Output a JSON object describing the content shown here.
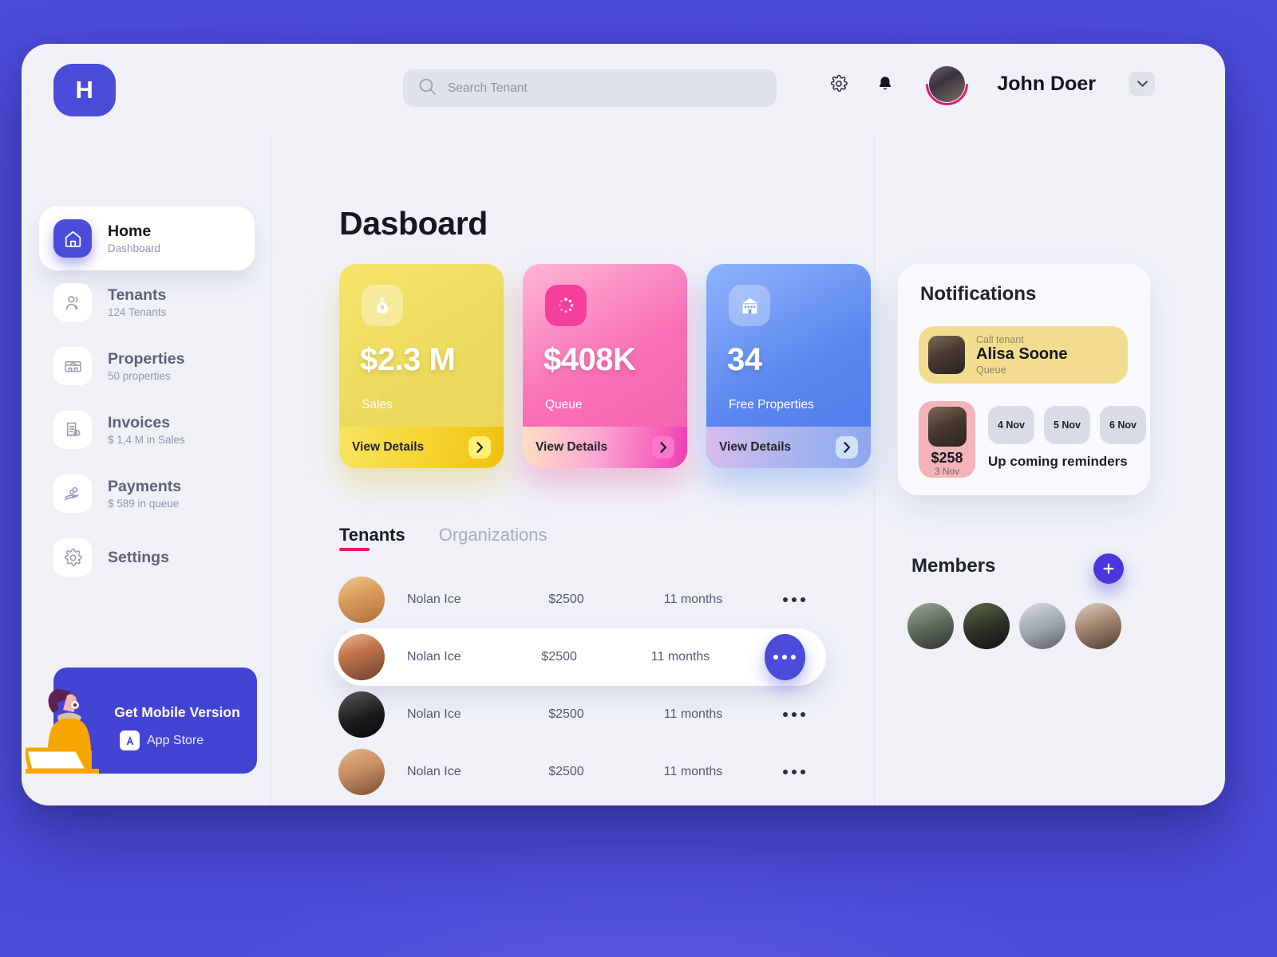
{
  "brand": {
    "logo_letter": "H",
    "accent": "#4b4cd9",
    "pink_accent": "#e8196b"
  },
  "topbar": {
    "search": {
      "placeholder": "Search Tenant",
      "value": ""
    },
    "settings_icon": "gear-icon",
    "bell_icon": "bell-icon",
    "user_name": "John Doer",
    "chevron_icon": "chevron-down-icon"
  },
  "sidebar": {
    "items": [
      {
        "label": "Home",
        "sub": "Dashboard",
        "icon": "home-icon",
        "active": true
      },
      {
        "label": "Tenants",
        "sub": "124 Tenants",
        "icon": "users-icon",
        "active": false
      },
      {
        "label": "Properties",
        "sub": "50 properties",
        "icon": "building-icon",
        "active": false
      },
      {
        "label": "Invoices",
        "sub": "$ 1,4 M in Sales",
        "icon": "invoice-icon",
        "active": false
      },
      {
        "label": "Payments",
        "sub": "$ 589 in queue",
        "icon": "payment-icon",
        "active": false
      },
      {
        "label": "Settings",
        "sub": "",
        "icon": "gear-icon",
        "active": false
      }
    ],
    "promo": {
      "title": "Get Mobile Version",
      "store": "App Store",
      "store_icon": "app-store-icon"
    }
  },
  "main": {
    "page_title": "Dasboard",
    "cards": [
      {
        "value": "$2.3 M",
        "label": "Sales",
        "cta": "View Details",
        "icon": "money-bag-icon",
        "color": "#ecda5d",
        "theme": "yellow"
      },
      {
        "value": "$408K",
        "label": "Queue",
        "cta": "View Details",
        "icon": "spinner-icon",
        "color": "#f970b6",
        "theme": "pink"
      },
      {
        "value": "34",
        "label": "Free Properties",
        "cta": "View Details",
        "icon": "building-icon",
        "color": "#5a86ef",
        "theme": "blue"
      }
    ],
    "tabs": [
      {
        "label": "Tenants",
        "active": true
      },
      {
        "label": "Organizations",
        "active": false
      }
    ],
    "rows": [
      {
        "name": "Nolan Ice",
        "amount": "$2500",
        "duration": "11 months",
        "selected": false
      },
      {
        "name": "Nolan Ice",
        "amount": "$2500",
        "duration": "11 months",
        "selected": true
      },
      {
        "name": "Nolan Ice",
        "amount": "$2500",
        "duration": "11 months",
        "selected": false
      },
      {
        "name": "Nolan Ice",
        "amount": "$2500",
        "duration": "11 months",
        "selected": false
      }
    ]
  },
  "right": {
    "notifications": {
      "title": "Notifications",
      "item": {
        "kicker": "Call tenant",
        "name": "Alisa Soone",
        "status": "Queue"
      },
      "reminder": {
        "amount": "$258",
        "day": "3 Nov"
      },
      "chips": [
        "4 Nov",
        "5 Nov",
        "6 Nov"
      ],
      "reminders_label": "Up coming reminders"
    },
    "members": {
      "title": "Members",
      "add_icon": "plus-icon",
      "count": 4
    }
  }
}
